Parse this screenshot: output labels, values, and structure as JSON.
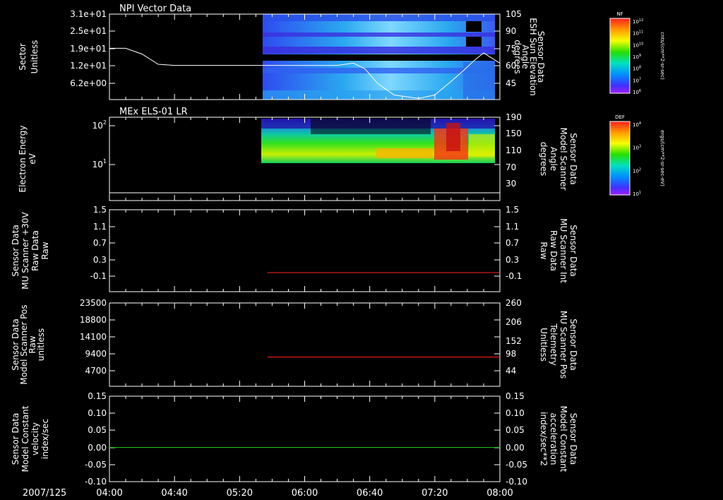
{
  "chart_data": [
    {
      "type": "heatmap",
      "title": "NPI Vector Data",
      "ylabel": [
        "Sector",
        "Unitless"
      ],
      "yticks": [
        "3.1e+01",
        "2.5e+01",
        "1.9e+01",
        "1.2e+01",
        "6.2e+00"
      ],
      "y2label": [
        "Sensor Data",
        "ESH Sun Elevation",
        "Angle",
        "degrees"
      ],
      "y2ticks": [
        "105",
        "90",
        "75",
        "60",
        "45"
      ],
      "y2lim": [
        30,
        105
      ],
      "line_series": {
        "x": [
          "04:00",
          "04:10",
          "04:20",
          "04:30",
          "04:40",
          "05:00",
          "05:20",
          "05:40",
          "06:00",
          "06:20",
          "06:30",
          "06:37",
          "06:45",
          "06:55",
          "07:10",
          "07:20",
          "07:30",
          "07:38",
          "07:44",
          "07:50",
          "08:00"
        ],
        "y": [
          75,
          75,
          70,
          61,
          60,
          60,
          60,
          60,
          60,
          60,
          62,
          57,
          44,
          34,
          31,
          34,
          46,
          56,
          64,
          71,
          62
        ]
      },
      "colorbar": {
        "label": "NF",
        "units": "cnts/(cm**2-sr-sec)",
        "ticks": [
          "10^12",
          "10^11",
          "10^10",
          "10^9",
          "10^8",
          "10^7",
          "10^6"
        ]
      }
    },
    {
      "type": "heatmap",
      "title": "MEx ELS-01 LR",
      "ylabel": [
        "Electron Energy",
        "eV"
      ],
      "yticks": [
        "10^2",
        "10^1"
      ],
      "y2label": [
        "Sensor Data",
        "Model Scanner",
        "Angle",
        "degrees"
      ],
      "y2ticks": [
        "190",
        "150",
        "110",
        "70",
        "30"
      ],
      "line_series": {
        "x": [
          "04:00",
          "08:00"
        ],
        "y": [
          20,
          20
        ]
      },
      "colorbar": {
        "label": "DEF",
        "units": "ergs/(cm**2-sr-sec-eV)",
        "ticks": [
          "10^4",
          "10^3",
          "10^2",
          "10^1"
        ]
      }
    },
    {
      "type": "line",
      "ylabel": [
        "Sensor Data",
        "MU Scanner +30V",
        "Raw Data",
        "Raw"
      ],
      "yticks": [
        "1.5",
        "1.1",
        "0.7",
        "0.3",
        "-0.1"
      ],
      "y2label": [
        "Sensor Data",
        "MU Scanner Int",
        "Raw Data",
        "Raw"
      ],
      "y2ticks": [
        "1.5",
        "1.1",
        "0.7",
        "0.3",
        "-0.1"
      ],
      "ylim": [
        -0.5,
        1.5
      ],
      "series": [
        {
          "color": "#ff2020",
          "x": [
            "05:37",
            "08:00"
          ],
          "y": [
            0,
            0
          ]
        }
      ]
    },
    {
      "type": "line",
      "ylabel": [
        "Sensor Data",
        "Model Scanner Pos",
        "Raw",
        "unitless"
      ],
      "yticks": [
        "23500",
        "18800",
        "14100",
        "9400",
        "4700"
      ],
      "y2label": [
        "Sensor Data",
        "MU Scanner Pos",
        "Telemetry",
        "Unitless"
      ],
      "y2ticks": [
        "260",
        "206",
        "152",
        "98",
        "44"
      ],
      "y2lim": [
        -10,
        260
      ],
      "series": [
        {
          "color": "#ff2020",
          "x": [
            "05:37",
            "08:00"
          ],
          "y": [
            85,
            85
          ]
        }
      ]
    },
    {
      "type": "line",
      "ylabel": [
        "Sensor Data",
        "Model Constant",
        "velocity",
        "index/sec"
      ],
      "yticks": [
        "0.15",
        "0.10",
        "0.05",
        "0.00",
        "-0.05",
        "-0.10"
      ],
      "y2label": [
        "Sensor Data",
        "Model Constant",
        "acceleration",
        "index/sec**2"
      ],
      "y2ticks": [
        "0.15",
        "0.10",
        "0.05",
        "0.00",
        "-0.05",
        "-0.10"
      ],
      "ylim": [
        -0.1,
        0.15
      ],
      "series": [
        {
          "color": "#20d020",
          "x": [
            "04:00",
            "08:00"
          ],
          "y": [
            0,
            0
          ]
        }
      ]
    }
  ],
  "time_axis": {
    "date": "2007/125",
    "ticks": [
      "04:00",
      "04:40",
      "05:20",
      "06:00",
      "06:40",
      "07:20",
      "08:00"
    ]
  },
  "colors": {
    "left_label": "#ffffff",
    "right_label_panel3": "#ff2020",
    "right_label_panel4": "#ff2020",
    "right_label_panel5": "#20d020"
  }
}
